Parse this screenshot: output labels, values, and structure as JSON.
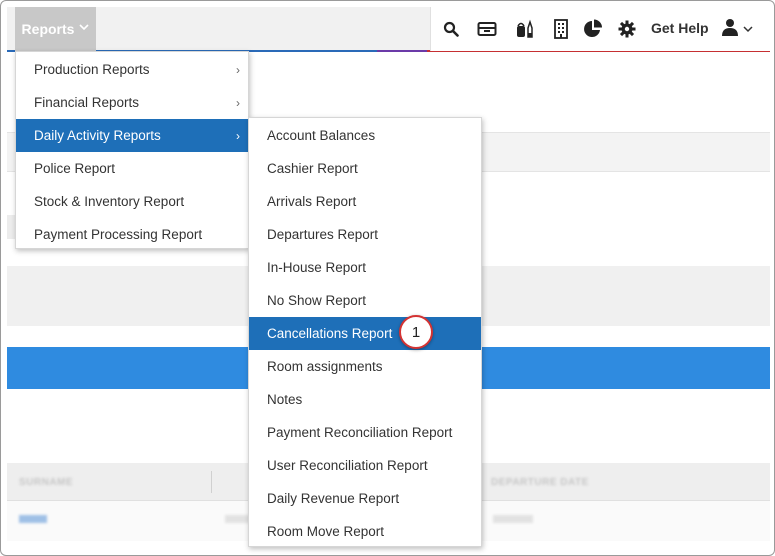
{
  "header": {
    "reports_label": "Reports",
    "chevron": "chevron-down",
    "get_help_label": "Get Help",
    "toolbar_icons": [
      "search-icon",
      "inbox-tray-icon",
      "cleaning-supplies-icon",
      "building-icon",
      "pie-chart-icon",
      "gear-icon"
    ],
    "user_icon": "user-icon"
  },
  "reports_menu": {
    "items": [
      {
        "label": "Production Reports",
        "has_submenu": true
      },
      {
        "label": "Financial Reports",
        "has_submenu": true
      },
      {
        "label": "Daily Activity Reports",
        "has_submenu": true,
        "active": true
      },
      {
        "label": "Police Report",
        "has_submenu": false
      },
      {
        "label": "Stock & Inventory Report",
        "has_submenu": false
      },
      {
        "label": "Payment Processing Report",
        "has_submenu": false
      }
    ]
  },
  "daily_activity_submenu": {
    "items": [
      {
        "label": "Account Balances"
      },
      {
        "label": "Cashier Report"
      },
      {
        "label": "Arrivals Report"
      },
      {
        "label": "Departures Report"
      },
      {
        "label": "In-House Report"
      },
      {
        "label": "No Show Report"
      },
      {
        "label": "Cancellations Report",
        "active": true
      },
      {
        "label": "Room assignments"
      },
      {
        "label": "Notes"
      },
      {
        "label": "Payment Reconciliation Report"
      },
      {
        "label": "User Reconciliation Report"
      },
      {
        "label": "Daily Revenue Report"
      },
      {
        "label": "Room Move Report"
      }
    ]
  },
  "callout": {
    "number": "1"
  },
  "background_table": {
    "headers": [
      "SURNAME",
      "DEPARTURE DATE"
    ]
  },
  "colors": {
    "menu_active": "#1e6fb8",
    "callout_border": "#d43333",
    "blue_band": "#2f8be0"
  }
}
